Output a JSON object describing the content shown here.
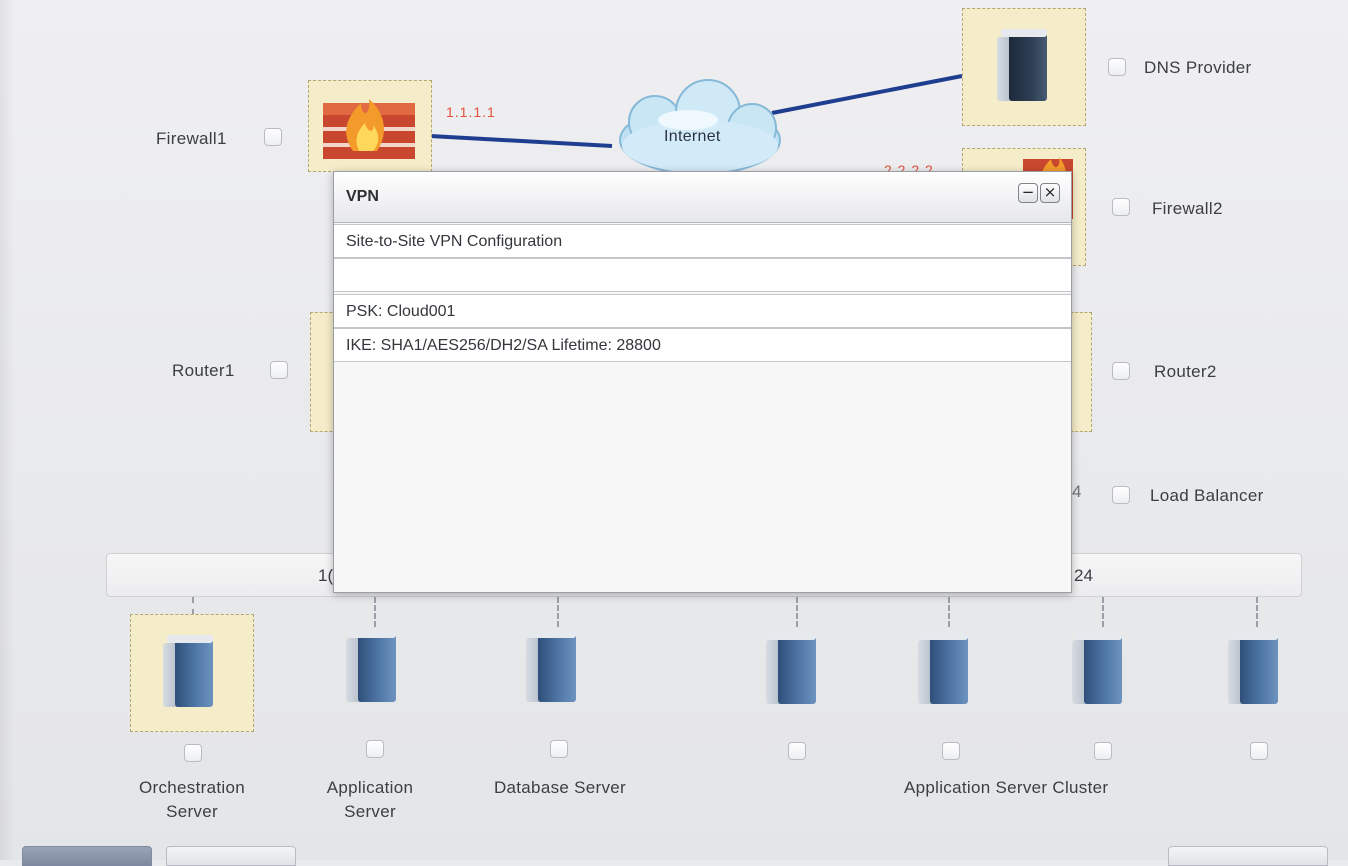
{
  "diagram": {
    "internet_label": "Internet",
    "ip_firewall1": "1.1.1.1",
    "ip_firewall2": "2.2.2.2",
    "subnet_left_fragment": "1(",
    "subnet_right_fragment": "24",
    "load_balancer_fragment": "4",
    "devices": {
      "firewall1": "Firewall1",
      "firewall2": "Firewall2",
      "router1": "Router1",
      "router2": "Router2",
      "dns_provider": "DNS Provider",
      "load_balancer": "Load Balancer",
      "orchestration_server": "Orchestration Server",
      "application_server": "Application Server",
      "database_server": "Database Server",
      "application_server_cluster": "Application Server Cluster"
    },
    "colors": {
      "link": "#1f3e8f",
      "ip_text": "#e3513b",
      "selected_node": "#f5edc9"
    }
  },
  "vpn_window": {
    "title": "VPN",
    "minimize_symbol": "−",
    "close_symbol": "×",
    "rows": {
      "heading": "Site-to-Site VPN Configuration",
      "blank": "",
      "psk": "PSK: Cloud001",
      "ike": "IKE: SHA1/AES256/DH2/SA Lifetime: 28800"
    }
  }
}
